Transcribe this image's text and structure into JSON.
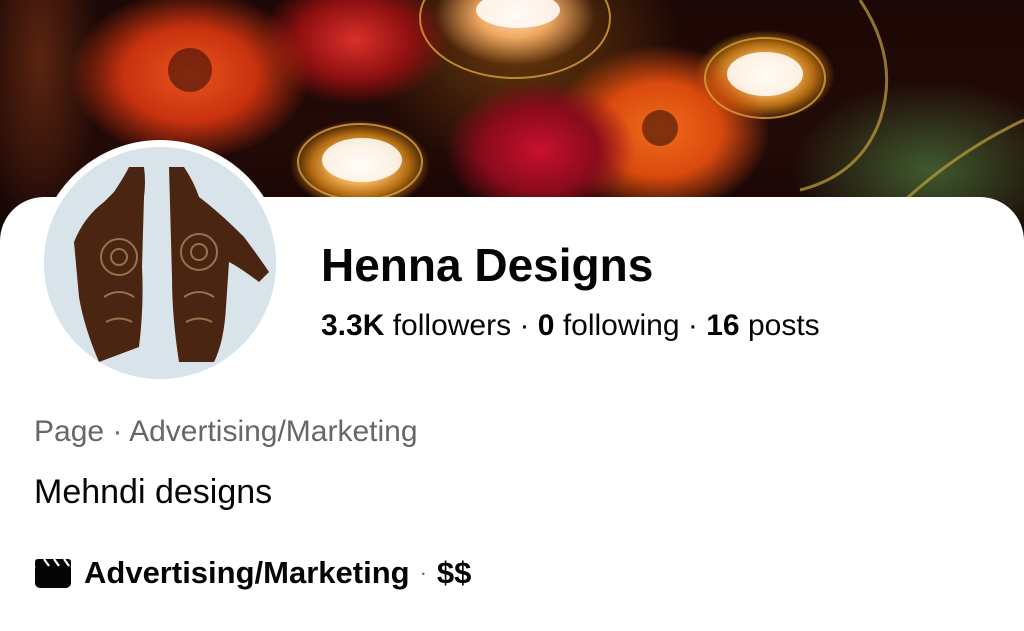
{
  "page": {
    "name": "Henna Designs",
    "stats": {
      "followers_count": "3.3K",
      "followers_label": "followers",
      "following_count": "0",
      "following_label": "following",
      "posts_count": "16",
      "posts_label": "posts",
      "separator": "·"
    },
    "category_line": "Page · Advertising/Marketing",
    "intro": "Mehndi designs",
    "info": {
      "icon": "clapperboard-icon",
      "category": "Advertising/Marketing",
      "separator": "·",
      "price_range": "$$"
    }
  },
  "colors": {
    "primary_text": "#050505",
    "secondary_text": "#65676b",
    "background": "#ffffff"
  }
}
